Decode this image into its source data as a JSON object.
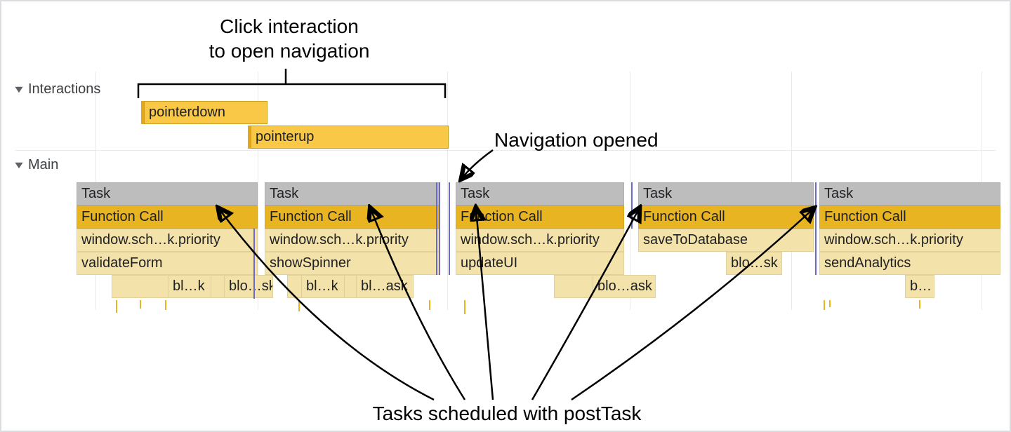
{
  "annotations": {
    "top": "Click interaction\nto open navigation",
    "right": "Navigation opened",
    "bottom": "Tasks scheduled with postTask"
  },
  "tracks": {
    "interactions_label": "Interactions",
    "main_label": "Main"
  },
  "interactions": {
    "pointerdown": "pointerdown",
    "pointerup": "pointerup"
  },
  "generic": {
    "task": "Task",
    "function_call": "Function Call"
  },
  "tasks": [
    {
      "sched": "window.sch…k.priority",
      "work": "validateForm",
      "blocks": [
        "bl…k",
        "blo…sk"
      ]
    },
    {
      "sched": "window.sch…k.priority",
      "work": "showSpinner",
      "blocks": [
        "bl…k",
        "bl…ask"
      ]
    },
    {
      "sched": "window.sch…k.priority",
      "work": "updateUI",
      "blocks": [
        "blo…ask"
      ]
    },
    {
      "sched": "saveToDatabase",
      "work": "blo…sk",
      "blocks": []
    },
    {
      "sched": "window.sch…k.priority",
      "work": "sendAnalytics",
      "blocks": [
        "b…"
      ]
    }
  ],
  "gridlines": [
    134,
    365,
    635,
    895,
    1125,
    1396
  ]
}
